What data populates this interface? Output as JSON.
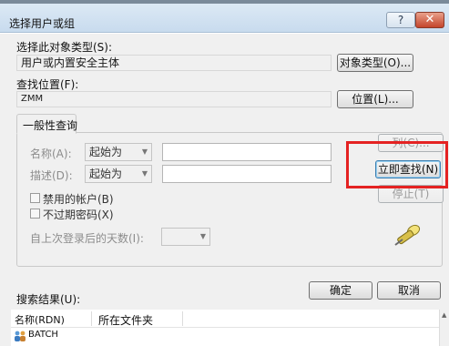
{
  "window": {
    "title": "选择用户或组",
    "help_label": "?",
    "close_label": "✕"
  },
  "object_type": {
    "label": "选择此对象类型(S):",
    "value": "用户或内置安全主体",
    "button": "对象类型(O)..."
  },
  "location": {
    "label": "查找位置(F):",
    "value": "ZMM",
    "button": "位置(L)..."
  },
  "common_query": {
    "tab_label": "一般性查询",
    "name_label": "名称(A):",
    "name_mode": "起始为",
    "desc_label": "描述(D):",
    "desc_mode": "起始为",
    "disabled_accounts": "禁用的帐户(B)",
    "non_expiring_pwd": "不过期密码(X)",
    "days_since_login": "自上次登录后的天数(I):"
  },
  "side_buttons": {
    "columns": "列(C)...",
    "find_now": "立即查找(N)",
    "stop": "停止(T)"
  },
  "icons": {
    "search": "search-flashlight-icon",
    "principal": "group-principal-icon"
  },
  "dialog_buttons": {
    "ok": "确定",
    "cancel": "取消"
  },
  "results": {
    "label": "搜索结果(U):",
    "columns": [
      "名称(RDN)",
      "所在文件夹"
    ],
    "rows": [
      {
        "name": "BATCH",
        "folder": ""
      }
    ]
  },
  "colors": {
    "highlight": "#e42222",
    "titlebar": "#c8dbee"
  }
}
